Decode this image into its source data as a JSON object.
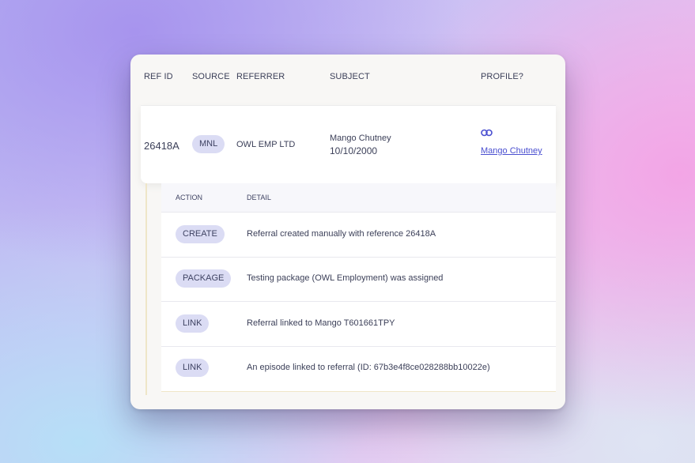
{
  "table": {
    "headers": {
      "ref_id": "REF ID",
      "source": "SOURCE",
      "referrer": "REFERRER",
      "subject": "SUBJECT",
      "profile": "PROFILE?"
    },
    "row": {
      "ref_id": "26418A",
      "source": "MNL",
      "referrer": "OWL EMP LTD",
      "subject_name": "Mango Chutney",
      "subject_dob": "10/10/2000",
      "profile_link_icon": "link-icon",
      "profile_link": "Mango Chutney"
    }
  },
  "detail": {
    "headers": {
      "action": "ACTION",
      "detail": "DETAIL"
    },
    "rows": [
      {
        "action": "CREATE",
        "detail": "Referral created manually with reference 26418A"
      },
      {
        "action": "PACKAGE",
        "detail": "Testing package (OWL Employment) was assigned"
      },
      {
        "action": "LINK",
        "detail": "Referral linked to Mango T601661TPY"
      },
      {
        "action": "LINK",
        "detail": "An episode linked to referral (ID: 67b3e4f8ce028288bb10022e)"
      }
    ]
  },
  "colors": {
    "accent": "#4a4fd0",
    "pill_bg": "#dbdcf4",
    "expand_border": "#efe6c8"
  }
}
